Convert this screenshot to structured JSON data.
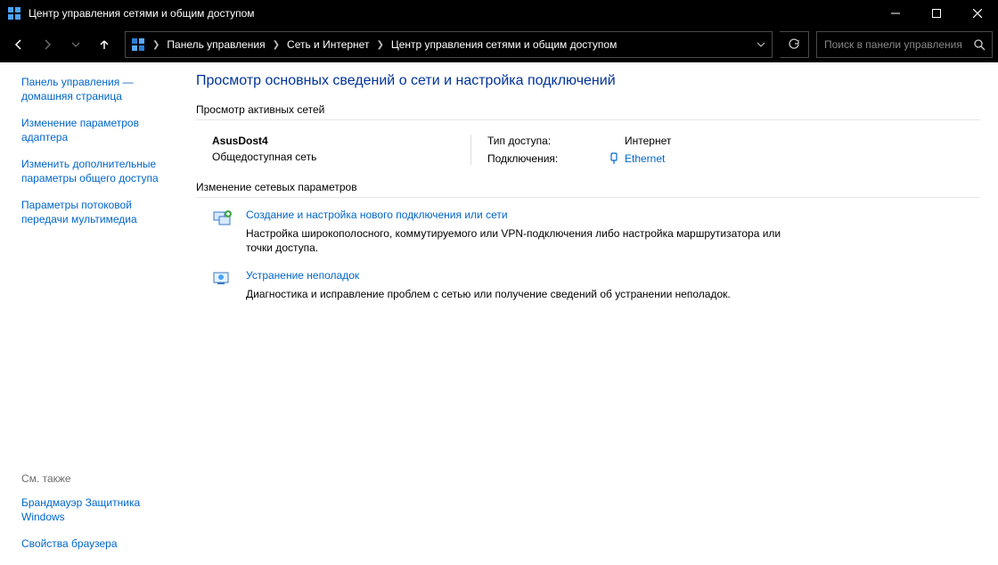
{
  "window": {
    "title": "Центр управления сетями и общим доступом"
  },
  "breadcrumb": {
    "items": [
      "Панель управления",
      "Сеть и Интернет",
      "Центр управления сетями и общим доступом"
    ]
  },
  "search": {
    "placeholder": "Поиск в панели управления"
  },
  "sidebar": {
    "home": "Панель управления — домашняя страница",
    "links": [
      "Изменение параметров адаптера",
      "Изменить дополнительные параметры общего доступа",
      "Параметры потоковой передачи мультимедиа"
    ],
    "see_also_label": "См. также",
    "see_also": [
      "Брандмауэр Защитника Windows",
      "Свойства браузера"
    ]
  },
  "main": {
    "heading": "Просмотр основных сведений о сети и настройка подключений",
    "active_label": "Просмотр активных сетей",
    "network": {
      "name": "AsusDost4",
      "category": "Общедоступная сеть",
      "access_label": "Тип доступа:",
      "access_value": "Интернет",
      "conn_label": "Подключения:",
      "conn_value": "Ethernet"
    },
    "change_label": "Изменение сетевых параметров",
    "change_items": [
      {
        "link": "Создание и настройка нового подключения или сети",
        "desc": "Настройка широкополосного, коммутируемого или VPN-подключения либо настройка маршрутизатора или точки доступа."
      },
      {
        "link": "Устранение неполадок",
        "desc": "Диагностика и исправление проблем с сетью или получение сведений об устранении неполадок."
      }
    ]
  }
}
